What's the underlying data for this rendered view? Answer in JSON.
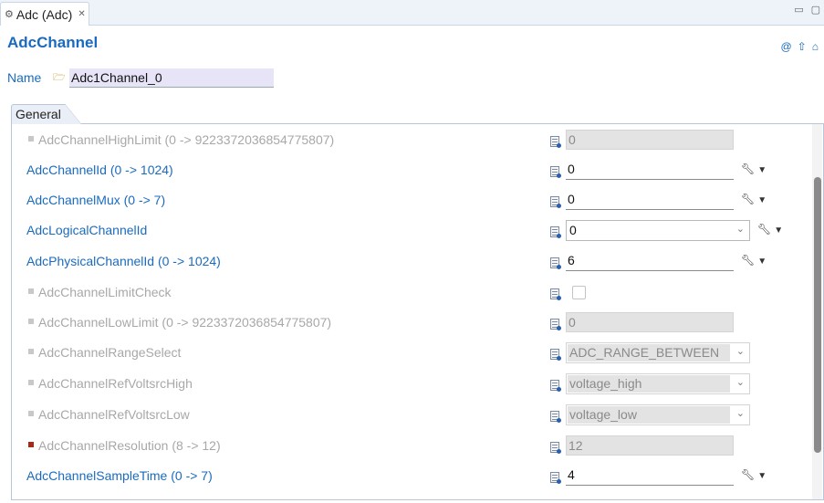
{
  "editor_tab": {
    "title": "Adc (Adc)",
    "close_glyph": "✕"
  },
  "window_controls": {
    "minimize": "▭",
    "maximize": "▢"
  },
  "form": {
    "title": "AdcChannel"
  },
  "title_tools": [
    "@",
    "⇧",
    "⌂"
  ],
  "name_field": {
    "label": "Name",
    "value": "Adc1Channel_0"
  },
  "section_tab": "General",
  "rows": [
    {
      "label": "AdcChannelHighLimit (0 -> 9223372036854775807)",
      "enabled": false,
      "value": "0",
      "control": "text",
      "has_action": false,
      "bullet": "gray"
    },
    {
      "label": "AdcChannelId (0 -> 1024)",
      "enabled": true,
      "value": "0",
      "control": "text",
      "has_action": true
    },
    {
      "label": "AdcChannelMux (0 -> 7)",
      "enabled": true,
      "value": "0",
      "control": "text",
      "has_action": true
    },
    {
      "label": "AdcLogicalChannelId",
      "enabled": true,
      "value": "0",
      "control": "combo",
      "has_action": true
    },
    {
      "label": "AdcPhysicalChannelId (0 -> 1024)",
      "enabled": true,
      "value": "6",
      "control": "text",
      "has_action": true
    },
    {
      "label": "AdcChannelLimitCheck",
      "enabled": false,
      "value": "",
      "control": "checkbox",
      "has_action": false,
      "bullet": "gray"
    },
    {
      "label": "AdcChannelLowLimit (0 -> 9223372036854775807)",
      "enabled": false,
      "value": "0",
      "control": "text",
      "has_action": false,
      "bullet": "gray"
    },
    {
      "label": "AdcChannelRangeSelect",
      "enabled": false,
      "value": "ADC_RANGE_BETWEEN",
      "control": "combo",
      "has_action": false,
      "bullet": "gray"
    },
    {
      "label": "AdcChannelRefVoltsrcHigh",
      "enabled": false,
      "value": "voltage_high",
      "control": "combo",
      "has_action": false,
      "bullet": "gray"
    },
    {
      "label": "AdcChannelRefVoltsrcLow",
      "enabled": false,
      "value": "voltage_low",
      "control": "combo",
      "has_action": false,
      "bullet": "gray"
    },
    {
      "label": "AdcChannelResolution (8 -> 12)",
      "enabled": false,
      "value": "12",
      "control": "text",
      "has_action": false,
      "bullet": "red"
    },
    {
      "label": "AdcChannelSampleTime (0 -> 7)",
      "enabled": true,
      "value": "4",
      "control": "text",
      "has_action": true
    }
  ],
  "icons": {
    "action": "wrench-icon",
    "dropdown": "chevron-down-icon",
    "field": "parameter-icon"
  },
  "colors": {
    "label_enabled": "#1a6bbf",
    "label_disabled": "#a8a8a8",
    "accent": "#1a6bbf"
  },
  "glyphs": {
    "tool": "🔧︎",
    "drop": "▼",
    "combo_caret": "⌄"
  }
}
